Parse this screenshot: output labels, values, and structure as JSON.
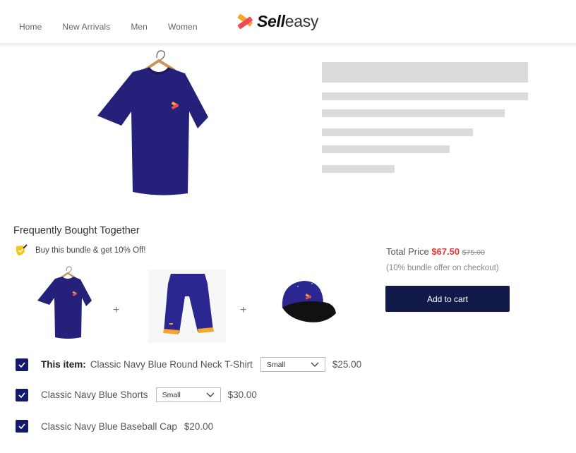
{
  "header": {
    "nav": [
      "Home",
      "New Arrivals",
      "Men",
      "Women"
    ],
    "logo": {
      "bold": "Sell",
      "light": "easy"
    }
  },
  "product": {
    "image": "navy-tshirt-on-hanger"
  },
  "fbt": {
    "title": "Frequently Bought Together",
    "promo": "Buy this bundle & get 10% Off!",
    "bundle_images": [
      "navy-tshirt",
      "navy-shorts",
      "navy-baseball-cap"
    ],
    "plus": "+"
  },
  "pricing": {
    "label": "Total Price",
    "current": "$67.50",
    "original": "$75.00",
    "note": "(10% bundle offer on checkout)",
    "button": "Add to cart"
  },
  "items": [
    {
      "prefix": "This item:",
      "name": "Classic Navy Blue Round Neck T-Shirt",
      "size": "Small",
      "price": "$25.00",
      "checked": true
    },
    {
      "prefix": "",
      "name": "Classic Navy Blue Shorts",
      "size": "Small",
      "price": "$30.00",
      "checked": true
    },
    {
      "prefix": "",
      "name": "Classic Navy Blue Baseball Cap",
      "size": "",
      "price": "$20.00",
      "checked": true
    }
  ],
  "colors": {
    "navy": "#14196b",
    "button": "#121a4a",
    "sale": "#e53935",
    "skeleton": "#dcdcdc"
  }
}
